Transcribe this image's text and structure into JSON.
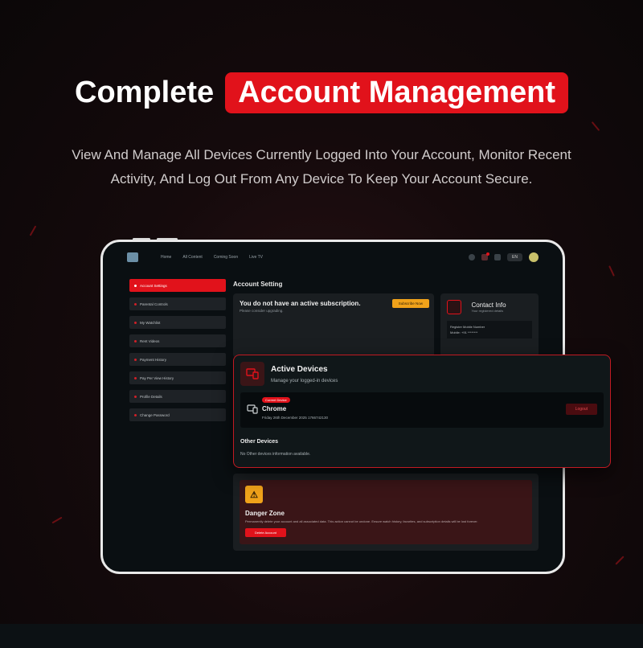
{
  "hero": {
    "title_plain": "Complete",
    "title_highlight": "Account Management",
    "subtitle": "View And Manage All Devices Currently Logged Into Your Account, Monitor Recent Activity, And Log Out From Any Device To Keep Your Account Secure."
  },
  "colors": {
    "accent": "#e1121b",
    "warning": "#f0a21a",
    "background": "#150a0c"
  },
  "app": {
    "nav": {
      "links": [
        "Home",
        "All Content",
        "Coming Soon",
        "Live TV"
      ],
      "language": "EN"
    },
    "sidebar": {
      "items": [
        {
          "label": "Account Settings",
          "active": true
        },
        {
          "label": "Parental Controls"
        },
        {
          "label": "My Watchlist"
        },
        {
          "label": "Rent Videos"
        },
        {
          "label": "Payment History"
        },
        {
          "label": "Pay Per View History"
        },
        {
          "label": "Profile Details"
        },
        {
          "label": "Change Password"
        }
      ]
    },
    "page_title": "Account Setting",
    "subscription": {
      "title": "You do not have an active subscription.",
      "note": "Please consider upgrading.",
      "button": "Subscribe Now"
    },
    "contact": {
      "title": "Contact Info",
      "subtitle": "Your registered details",
      "row_label": "Register Mobile Number",
      "row_value": "Mobile: +91 ********"
    },
    "danger": {
      "title": "Danger Zone",
      "text": "Permanently delete your account and all associated data. This action cannot be undone. Ensure watch history, favorites, and subscription details will be lost forever.",
      "button": "Delete Account"
    }
  },
  "devices": {
    "title": "Active Devices",
    "subtitle": "Manage your logged-in devices",
    "current": {
      "badge": "Current Device",
      "name": "Chrome",
      "time": "Friday 26th December 2025 1766742130",
      "logout": "Logout"
    },
    "other_title": "Other Devices",
    "other_note": "No Other devices information available."
  }
}
